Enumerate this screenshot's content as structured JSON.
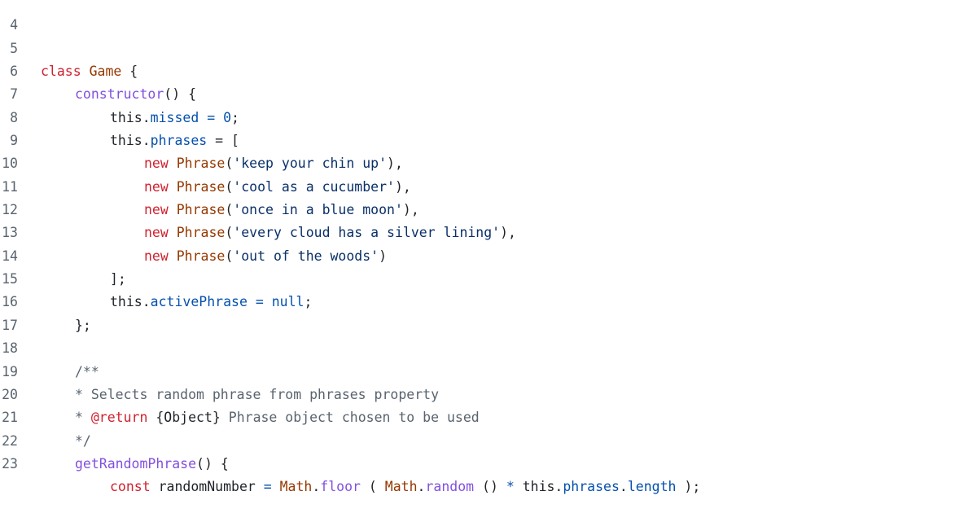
{
  "code": {
    "lines": [
      {
        "num": "4"
      },
      {
        "num": "5",
        "t": [
          "class",
          "Game",
          "{"
        ]
      },
      {
        "num": "6",
        "t": [
          "constructor",
          "() {"
        ]
      },
      {
        "num": "7",
        "t": [
          "this.",
          "missed",
          " = ",
          "0",
          ";"
        ]
      },
      {
        "num": "8",
        "t": [
          "this.",
          "phrases",
          " = ["
        ]
      },
      {
        "num": "9",
        "t": [
          "new",
          "Phrase",
          "(",
          "'keep your chin up'",
          "),"
        ]
      },
      {
        "num": "10",
        "t": [
          "new",
          "Phrase",
          "(",
          "'cool as a cucumber'",
          "),"
        ]
      },
      {
        "num": "11",
        "t": [
          "new",
          "Phrase",
          "(",
          "'once in a blue moon'",
          "),"
        ]
      },
      {
        "num": "12",
        "t": [
          "new",
          "Phrase",
          "(",
          "'every cloud has a silver lining'",
          "),"
        ]
      },
      {
        "num": "13",
        "t": [
          "new",
          "Phrase",
          "(",
          "'out of the woods'",
          ")"
        ]
      },
      {
        "num": "14",
        "t": [
          "];"
        ]
      },
      {
        "num": "15",
        "t": [
          "this.",
          "activePhrase",
          " = ",
          "null",
          ";"
        ]
      },
      {
        "num": "16",
        "t": [
          "};"
        ]
      },
      {
        "num": "17"
      },
      {
        "num": "18",
        "t": [
          "/**"
        ]
      },
      {
        "num": "19",
        "t": [
          "* Selects random phrase from phrases property"
        ]
      },
      {
        "num": "20",
        "t": [
          "* ",
          "@return",
          " {Object}",
          " Phrase object chosen to be used"
        ]
      },
      {
        "num": "21",
        "t": [
          "*/"
        ]
      },
      {
        "num": "22",
        "t": [
          "getRandomPhrase",
          "() {"
        ]
      },
      {
        "num": "23",
        "t": [
          "const",
          " randomNumber ",
          "=",
          " Math",
          ".",
          "floor",
          " ( ",
          "Math",
          ".",
          "random",
          " () ",
          "*",
          " this.",
          "phrases",
          ".",
          "length",
          " );"
        ]
      }
    ]
  }
}
